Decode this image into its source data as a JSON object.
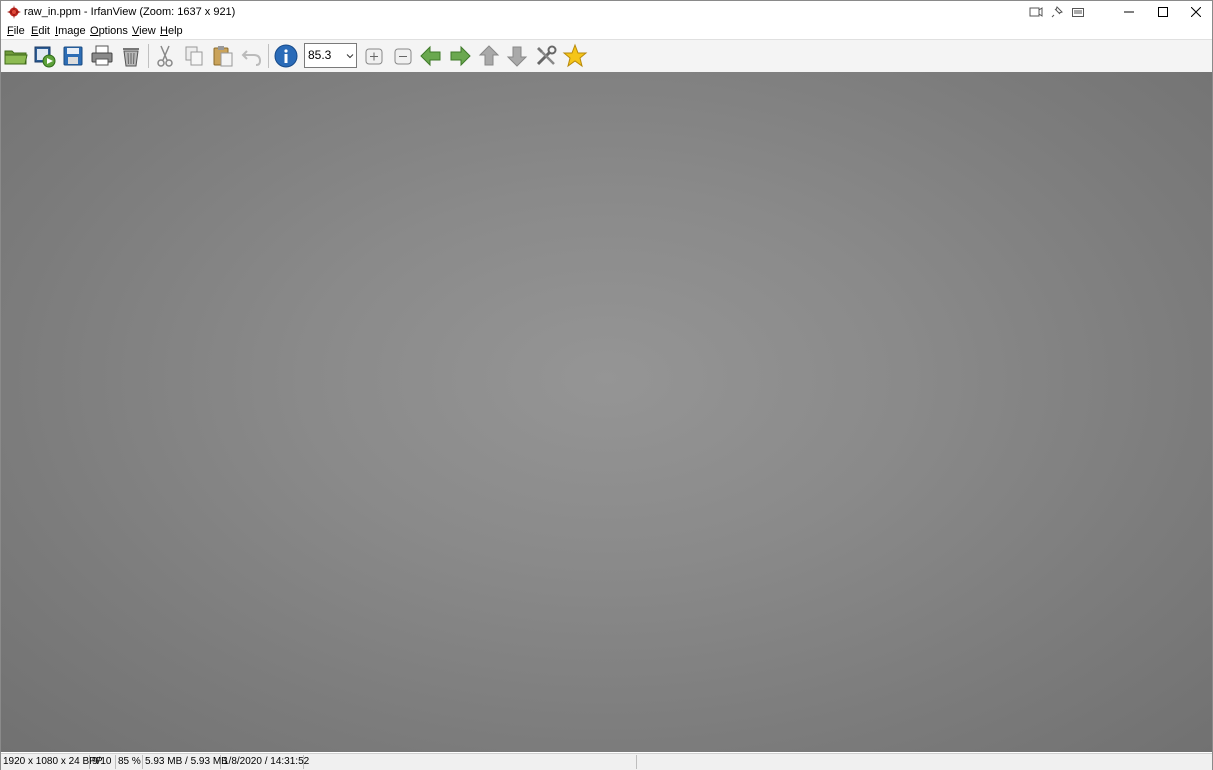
{
  "window": {
    "title": "raw_in.ppm - IrfanView (Zoom: 1637 x 921)"
  },
  "menu": [
    {
      "key": "F",
      "rest": "ile"
    },
    {
      "key": "E",
      "rest": "dit"
    },
    {
      "key": "I",
      "rest": "mage"
    },
    {
      "key": "O",
      "rest": "ptions"
    },
    {
      "key": "V",
      "rest": "iew"
    },
    {
      "key": "H",
      "rest": "elp"
    }
  ],
  "toolbar": {
    "zoom_value": "85.3",
    "icons": [
      "open-folder-icon",
      "slideshow-icon",
      "save-icon",
      "print-icon",
      "delete-icon",
      "cut-icon",
      "copy-icon",
      "paste-icon",
      "undo-icon",
      "info-icon",
      "zoom-in-icon",
      "zoom-out-icon",
      "previous-arrow-icon",
      "next-arrow-icon",
      "first-arrow-icon",
      "last-arrow-icon",
      "settings-tools-icon",
      "favorite-star-icon"
    ]
  },
  "status": {
    "dimensions": "1920 x 1080 x 24 BPP",
    "file_index": "9/10",
    "zoom_percent": "85 %",
    "memory": "5.93 MB / 5.93 MB",
    "datetime": "1/8/2020 / 14:31:52"
  },
  "colors": {
    "canvas_center": "#959595",
    "canvas_edge": "#717171",
    "toolbar_bg": "#f4f4f4",
    "arrow_green": "#6aa84f",
    "info_blue": "#2a6bb8"
  }
}
